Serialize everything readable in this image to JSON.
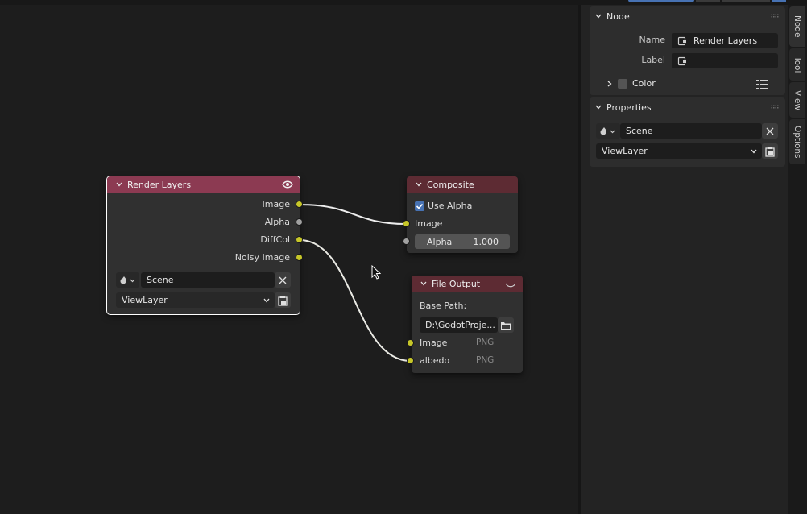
{
  "colors": {
    "socket_color": "#c7c729",
    "socket_value": "#a1a1a1",
    "node_header_selected": "#8c3a52",
    "node_header": "#5d2b33",
    "accent": "#4772b3"
  },
  "render_layers": {
    "title": "Render Layers",
    "outputs": [
      "Image",
      "Alpha",
      "DiffCol",
      "Noisy Image"
    ],
    "scene": "Scene",
    "view_layer": "ViewLayer"
  },
  "composite": {
    "title": "Composite",
    "use_alpha_label": "Use Alpha",
    "use_alpha_checked": true,
    "image_label": "Image",
    "alpha_label": "Alpha",
    "alpha_value": "1.000"
  },
  "file_output": {
    "title": "File Output",
    "base_path_label": "Base Path:",
    "base_path_value": "D:\\GodotProje...",
    "inputs": [
      {
        "name": "Image",
        "format": "PNG"
      },
      {
        "name": "albedo",
        "format": "PNG"
      }
    ]
  },
  "sidebar": {
    "node_panel": {
      "title": "Node",
      "name_label": "Name",
      "name_value": "Render Layers",
      "label_label": "Label",
      "label_value": "",
      "color_label": "Color"
    },
    "properties_panel": {
      "title": "Properties",
      "scene": "Scene",
      "view_layer": "ViewLayer"
    }
  },
  "tabs": [
    "Node",
    "Tool",
    "View",
    "Options"
  ]
}
